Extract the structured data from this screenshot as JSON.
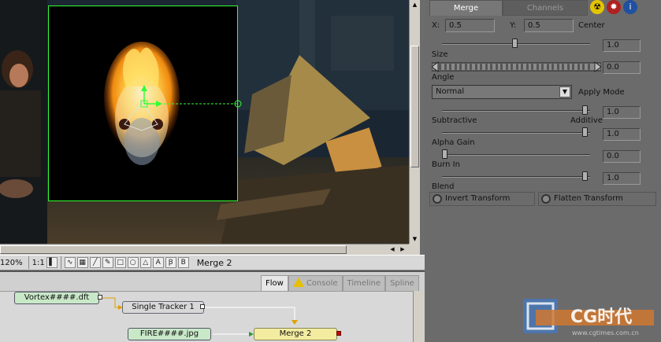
{
  "viewer": {
    "zoom": "120%",
    "ratio": "1:1",
    "active_tool_label": "Merge 2"
  },
  "flow": {
    "tabs": [
      {
        "label": "Flow",
        "active": true
      },
      {
        "label": "Console",
        "active": false
      },
      {
        "label": "Timeline",
        "active": false
      },
      {
        "label": "Spline",
        "active": false
      }
    ],
    "nodes": {
      "vortex": "Vortex####.dft",
      "tracker": "Single Tracker 1",
      "fire": "FIRE####.jpg",
      "merge": "Merge 2"
    }
  },
  "panel": {
    "tabs": [
      {
        "label": "Merge",
        "active": true
      },
      {
        "label": "Channels",
        "active": false
      }
    ],
    "icons": [
      "radioactive-icon",
      "gear-icon",
      "info-icon"
    ],
    "x_label": "X:",
    "x_value": "0.5",
    "y_label": "Y:",
    "y_value": "0.5",
    "center_label": "Center",
    "size_value": "1.0",
    "size_label": "Size",
    "angle_value": "0.0",
    "angle_label": "Angle",
    "apply_mode_value": "Normal",
    "apply_mode_label": "Apply Mode",
    "subtractive_label": "Subtractive",
    "additive_label": "Additive",
    "operator_value": "1.0",
    "alpha_gain_label": "Alpha Gain",
    "alpha_gain_value": "1.0",
    "burn_in_label": "Burn In",
    "burn_in_value": "0.0",
    "blend_label": "Blend",
    "blend_value": "1.0",
    "invert_transform_label": "Invert Transform",
    "flatten_transform_label": "Flatten Transform"
  },
  "watermark": {
    "brand": "CG时代",
    "site": "www.cgtimes.com.cn"
  },
  "colors": {
    "overlay_green": "#33ff33",
    "panel_bg": "#6b6b6b",
    "merge_node": "#f3eca0",
    "loader_node": "#c8e8c8",
    "watermark_blue": "#3a7bd5"
  }
}
